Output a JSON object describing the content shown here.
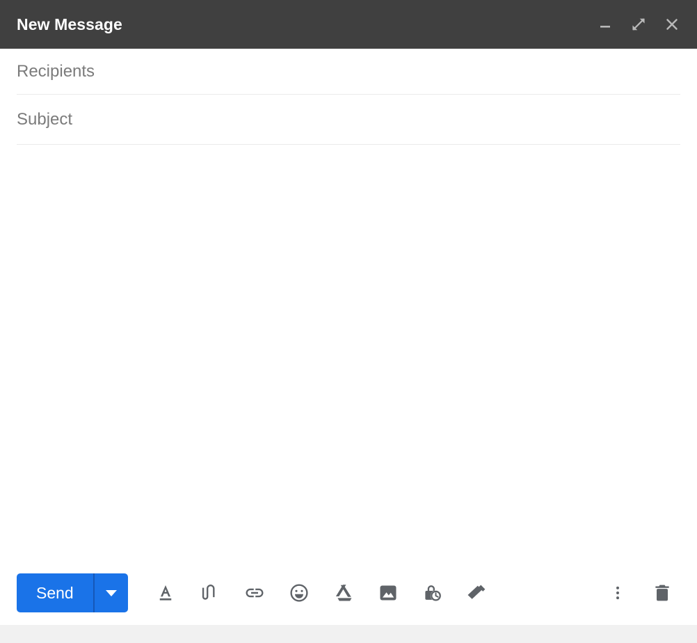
{
  "window": {
    "title": "New Message",
    "controls": [
      {
        "name": "minimize",
        "label": "Minimize"
      },
      {
        "name": "expand",
        "label": "Full screen"
      },
      {
        "name": "close",
        "label": "Save & close"
      }
    ]
  },
  "fields": {
    "recipients": {
      "placeholder": "Recipients",
      "value": ""
    },
    "subject": {
      "placeholder": "Subject",
      "value": ""
    },
    "body": {
      "value": ""
    }
  },
  "toolbar": {
    "send_label": "Send",
    "send_options_label": "More send options",
    "icons": [
      {
        "name": "formatting-options",
        "label": "Formatting options"
      },
      {
        "name": "attach-file",
        "label": "Attach files"
      },
      {
        "name": "insert-link",
        "label": "Insert link"
      },
      {
        "name": "insert-emoji",
        "label": "Insert emoji"
      },
      {
        "name": "insert-drive-file",
        "label": "Insert files using Drive"
      },
      {
        "name": "insert-photo",
        "label": "Insert photo"
      },
      {
        "name": "confidential-mode",
        "label": "Toggle confidential mode"
      },
      {
        "name": "insert-signature",
        "label": "Insert signature"
      }
    ],
    "right_icons": [
      {
        "name": "more-options",
        "label": "More options"
      },
      {
        "name": "discard-draft",
        "label": "Discard draft"
      }
    ]
  },
  "colors": {
    "titlebar_bg": "#404040",
    "accent_blue": "#1a73e8",
    "icon_gray": "#5f6368",
    "placeholder_gray": "#7b7b7b",
    "strip_gray": "#f1f1f1"
  }
}
